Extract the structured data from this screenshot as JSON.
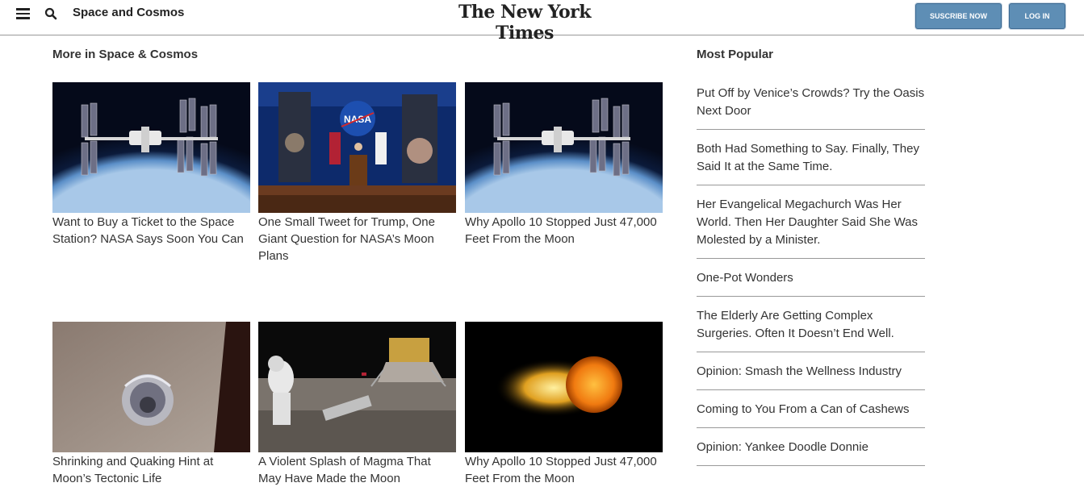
{
  "header": {
    "section_name": "Space and Cosmos",
    "masthead": "The New York Times",
    "subscribe_label": "SUSCRIBE NOW",
    "login_label": "LOG IN",
    "button_color": "#5e8eb5"
  },
  "more": {
    "heading": "More in Space & Cosmos",
    "articles": [
      {
        "title": "Want to Buy a Ticket to the Space Station? NASA Says Soon You Can",
        "image": "space-station-photo"
      },
      {
        "title": "One Small Tweet for Trump, One Giant Question for NASA’s Moon Plans",
        "image": "nasa-podium-photo"
      },
      {
        "title": "Why Apollo 10 Stopped Just 47,000 Feet From the Moon",
        "image": "space-station-photo"
      },
      {
        "title": "Shrinking and Quaking Hint at Moon’s Tectonic Life",
        "image": "apollo-capsule-photo"
      },
      {
        "title": "A Violent Splash of Magma That May Have Made the Moon",
        "image": "moon-landing-photo"
      },
      {
        "title": "Why Apollo 10 Stopped Just 47,000 Feet From the Moon",
        "image": "fiery-impact-photo"
      }
    ]
  },
  "popular": {
    "heading": "Most Popular",
    "items": [
      "Put Off by Venice’s Crowds? Try the Oasis Next Door",
      "Both Had Something to Say. Finally, They Said It at the Same Time.",
      "Her Evangelical Megachurch Was Her World. Then Her Daughter Said She Was Molested by a Minister.",
      "One-Pot Wonders",
      "The Elderly Are Getting Complex Surgeries. Often It Doesn’t End Well.",
      "Opinion: Smash the Wellness Industry",
      "Coming to You From a Can of Cashews",
      "Opinion: Yankee Doodle Donnie"
    ]
  }
}
